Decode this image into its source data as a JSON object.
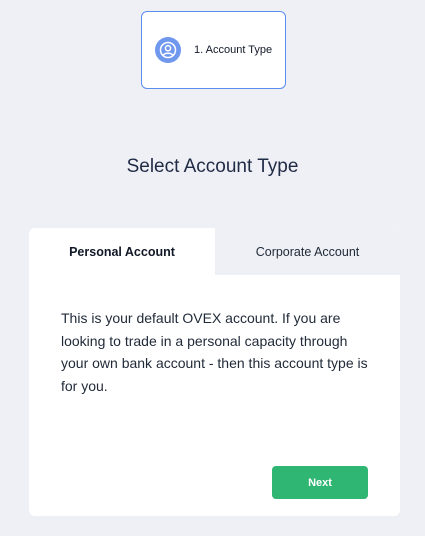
{
  "stepper": {
    "step_label": "1. Account Type",
    "icon": "user-circle-icon"
  },
  "page_title": "Select Account Type",
  "tabs": [
    {
      "label": "Personal Account",
      "active": true
    },
    {
      "label": "Corporate Account",
      "active": false
    }
  ],
  "description": "This is your default OVEX account. If you are looking to trade in a personal capacity through your own bank account - then this account type is for you.",
  "next_label": "Next",
  "colors": {
    "background": "#eef0f5",
    "accent_blue": "#5b8def",
    "next_green": "#2fb673"
  }
}
